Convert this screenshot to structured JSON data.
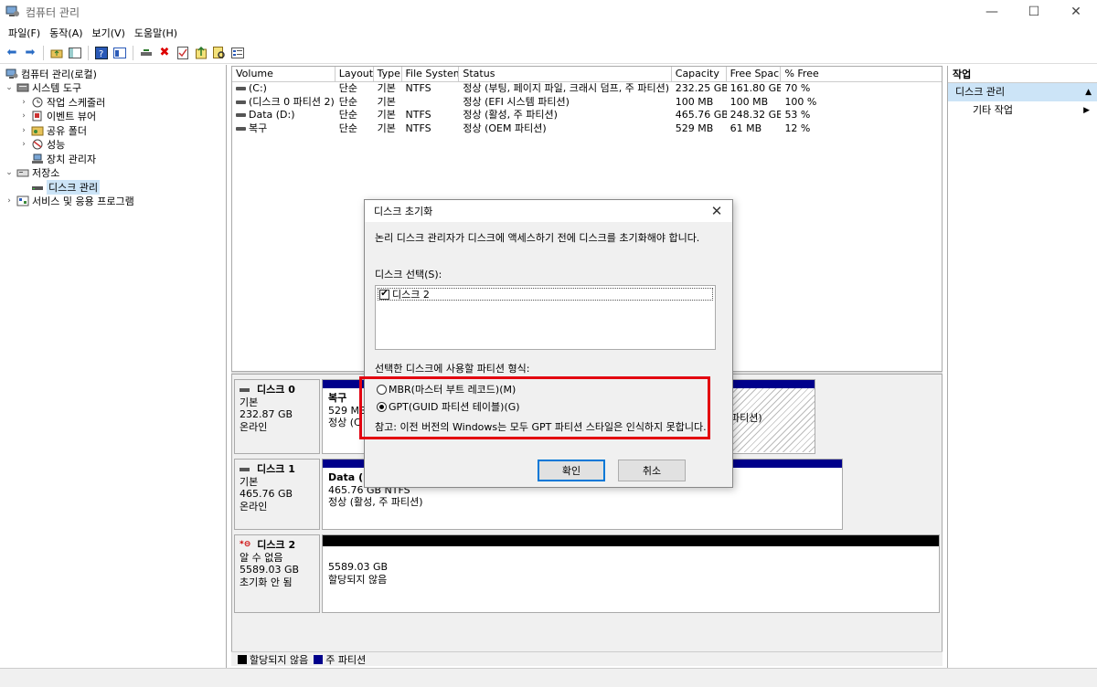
{
  "window": {
    "title": "컴퓨터 관리",
    "minimize": "—",
    "maximize": "☐",
    "close": "✕"
  },
  "menu": [
    "파일(F)",
    "동작(A)",
    "보기(V)",
    "도움말(H)"
  ],
  "tree": [
    {
      "label": "컴퓨터 관리(로컬)",
      "indent": 0,
      "expander": "",
      "icon": "computer-management-icon"
    },
    {
      "label": "시스템 도구",
      "indent": 1,
      "expander": "⌄",
      "icon": "system-tools-icon"
    },
    {
      "label": "작업 스케줄러",
      "indent": 2,
      "expander": "›",
      "icon": "task-scheduler-icon"
    },
    {
      "label": "이벤트 뷰어",
      "indent": 2,
      "expander": "›",
      "icon": "event-viewer-icon"
    },
    {
      "label": "공유 폴더",
      "indent": 2,
      "expander": "›",
      "icon": "shared-folders-icon"
    },
    {
      "label": "성능",
      "indent": 2,
      "expander": "›",
      "icon": "performance-icon"
    },
    {
      "label": "장치 관리자",
      "indent": 2,
      "expander": "",
      "icon": "device-manager-icon"
    },
    {
      "label": "저장소",
      "indent": 1,
      "expander": "⌄",
      "icon": "storage-icon"
    },
    {
      "label": "디스크 관리",
      "indent": 2,
      "expander": "",
      "icon": "disk-management-icon",
      "selected": true
    },
    {
      "label": "서비스 및 응용 프로그램",
      "indent": 1,
      "expander": "›",
      "icon": "services-apps-icon"
    }
  ],
  "volumes": {
    "headers": [
      "Volume",
      "Layout",
      "Type",
      "File System",
      "Status",
      "Capacity",
      "Free Space",
      "% Free"
    ],
    "rows": [
      [
        "(C:)",
        "단순",
        "기본",
        "NTFS",
        "정상 (부팅, 페이지 파일, 크래시 덤프, 주 파티션)",
        "232.25 GB",
        "161.80 GB",
        "70 %"
      ],
      [
        "(디스크 0 파티션 2)",
        "단순",
        "기본",
        "",
        "정상 (EFI 시스템 파티션)",
        "100 MB",
        "100 MB",
        "100 %"
      ],
      [
        "Data (D:)",
        "단순",
        "기본",
        "NTFS",
        "정상 (활성, 주 파티션)",
        "465.76 GB",
        "248.32 GB",
        "53 %"
      ],
      [
        "복구",
        "단순",
        "기본",
        "NTFS",
        "정상 (OEM 파티션)",
        "529 MB",
        "61 MB",
        "12 %"
      ]
    ]
  },
  "disks": {
    "disk0": {
      "name": "디스크 0",
      "type": "기본",
      "size": "232.87 GB",
      "state": "온라인",
      "part1": {
        "name": "복구",
        "size": "529 MB",
        "status": "정상 (C"
      },
      "part_tail": "파티션)"
    },
    "disk1": {
      "name": "디스크 1",
      "type": "기본",
      "size": "465.76 GB",
      "state": "온라인",
      "part1": {
        "name": "Data  (D",
        "size": "465.76 GB NTFS",
        "status": "정상 (활성, 주 파티션)"
      }
    },
    "disk2": {
      "name": "디스크 2",
      "type": "알 수 없음",
      "size": "5589.03 GB",
      "state": "초기화 안 됨",
      "part1": {
        "size": "5589.03 GB",
        "status": "할당되지 않음"
      }
    }
  },
  "legend": {
    "unallocated": "할당되지 않음",
    "primary": "주 파티션"
  },
  "actions": {
    "header": "작업",
    "section": "디스크 관리",
    "more": "기타 작업"
  },
  "dialog": {
    "title": "디스크 초기화",
    "message": "논리 디스크 관리자가 디스크에 액세스하기 전에 디스크를 초기화해야 합니다.",
    "select_label": "디스크 선택(S):",
    "disk_item": "디스크 2",
    "style_label": "선택한 디스크에 사용할 파티션 형식:",
    "mbr": "MBR(마스터 부트 레코드)(M)",
    "gpt": "GPT(GUID 파티션 테이블)(G)",
    "note": "참고: 이전 버전의 Windows는 모두 GPT 파티션 스타일은 인식하지 못합니다.",
    "ok": "확인",
    "cancel": "취소",
    "close": "✕"
  },
  "colors": {
    "primary_partition": "#00008b",
    "unallocated": "#000000",
    "highlight": "#e3000f",
    "selection": "#cce4f7"
  }
}
